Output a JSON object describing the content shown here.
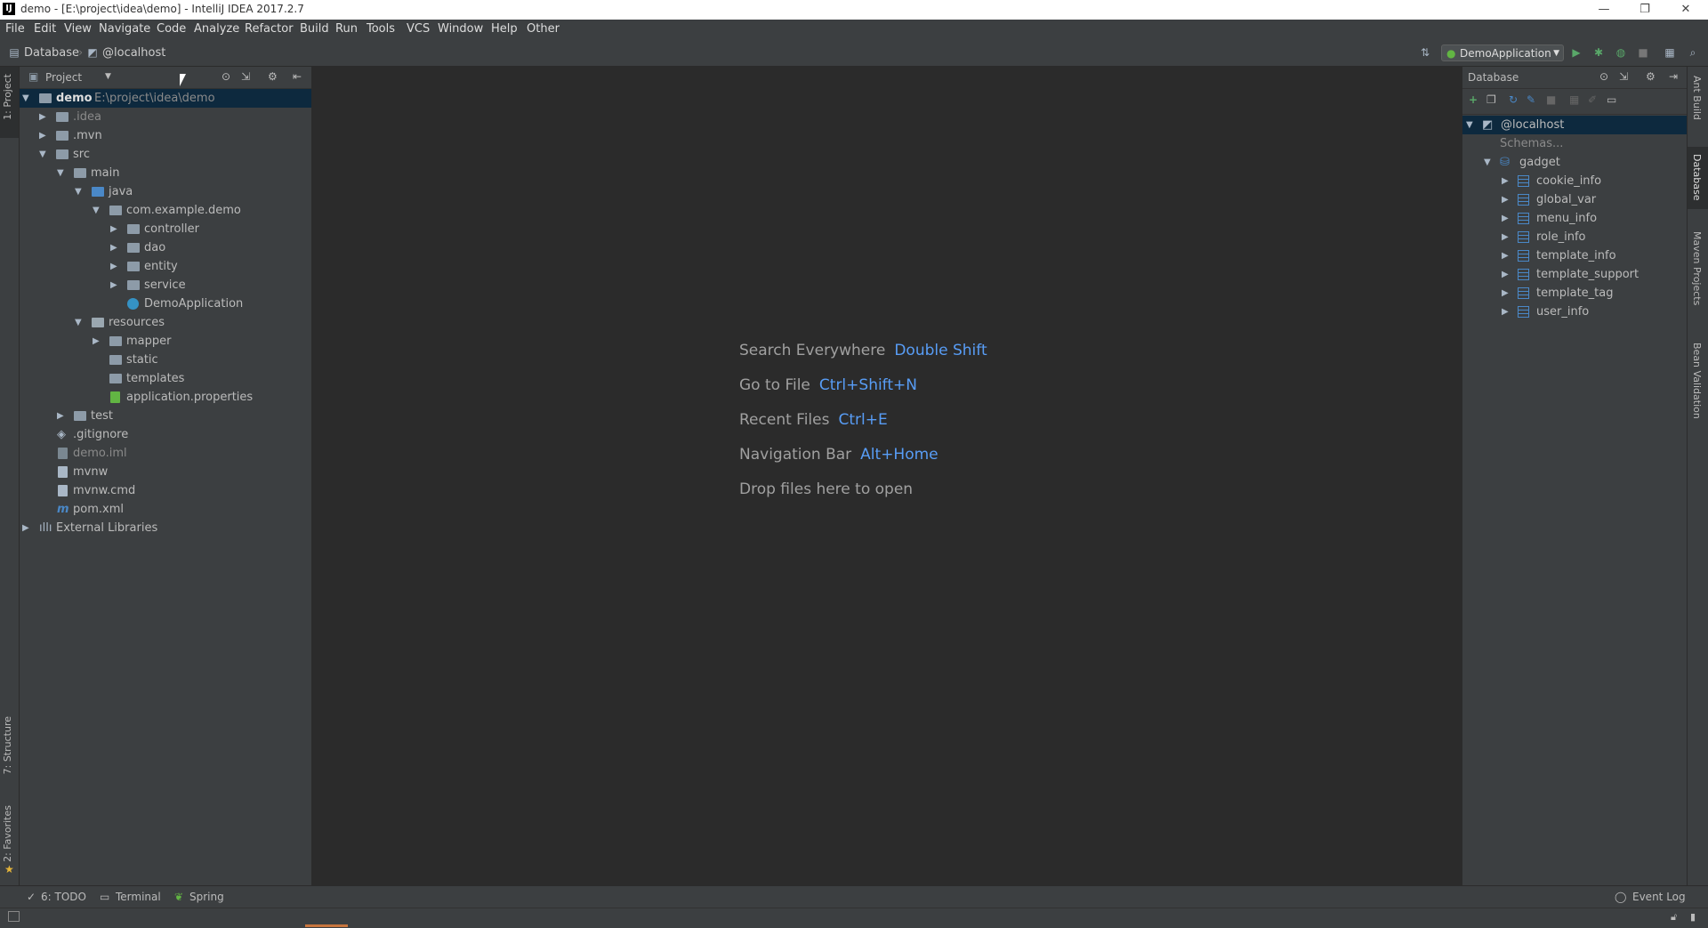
{
  "window": {
    "title": "demo - [E:\\project\\idea\\demo] - IntelliJ IDEA 2017.2.7",
    "minimize": "—",
    "restore": "❐",
    "close": "✕"
  },
  "menu": [
    "File",
    "Edit",
    "View",
    "Navigate",
    "Code",
    "Analyze",
    "Refactor",
    "Build",
    "Run",
    "Tools",
    "VCS",
    "Window",
    "Help",
    "Other"
  ],
  "breadcrumb": {
    "item1": "Database",
    "item2": "@localhost"
  },
  "run_config": "DemoApplication",
  "left_strip": {
    "project": "1: Project",
    "structure": "7: Structure",
    "favorites": "2: Favorites"
  },
  "project_panel": {
    "title": "Project",
    "tree": [
      {
        "label": "demo",
        "extra": "E:\\project\\idea\\demo"
      },
      {
        "label": ".idea"
      },
      {
        "label": ".mvn"
      },
      {
        "label": "src"
      },
      {
        "label": "main"
      },
      {
        "label": "java"
      },
      {
        "label": "com.example.demo"
      },
      {
        "label": "controller"
      },
      {
        "label": "dao"
      },
      {
        "label": "entity"
      },
      {
        "label": "service"
      },
      {
        "label": "DemoApplication"
      },
      {
        "label": "resources"
      },
      {
        "label": "mapper"
      },
      {
        "label": "static"
      },
      {
        "label": "templates"
      },
      {
        "label": "application.properties"
      },
      {
        "label": "test"
      },
      {
        "label": ".gitignore"
      },
      {
        "label": "demo.iml"
      },
      {
        "label": "mvnw"
      },
      {
        "label": "mvnw.cmd"
      },
      {
        "label": "pom.xml"
      },
      {
        "label": "External Libraries"
      }
    ]
  },
  "editor_hints": [
    {
      "text": "Search Everywhere",
      "key": "Double Shift"
    },
    {
      "text": "Go to File",
      "key": "Ctrl+Shift+N"
    },
    {
      "text": "Recent Files",
      "key": "Ctrl+E"
    },
    {
      "text": "Navigation Bar",
      "key": "Alt+Home"
    },
    {
      "text": "Drop files here to open",
      "key": ""
    }
  ],
  "database_panel": {
    "title": "Database",
    "host": "@localhost",
    "schemas": "Schemas...",
    "schema": "gadget",
    "tables": [
      "cookie_info",
      "global_var",
      "menu_info",
      "role_info",
      "template_info",
      "template_support",
      "template_tag",
      "user_info"
    ]
  },
  "right_strip": {
    "ant": "Ant Build",
    "database": "Database",
    "maven": "Maven Projects",
    "bean": "Bean Validation"
  },
  "bottom_tabs": {
    "todo": "6: TODO",
    "terminal": "Terminal",
    "spring": "Spring",
    "event_log": "Event Log"
  },
  "colors": {
    "accent": "#589df6",
    "background": "#2b2b2b",
    "panel": "#3c3f41",
    "selection": "#0d293e"
  }
}
